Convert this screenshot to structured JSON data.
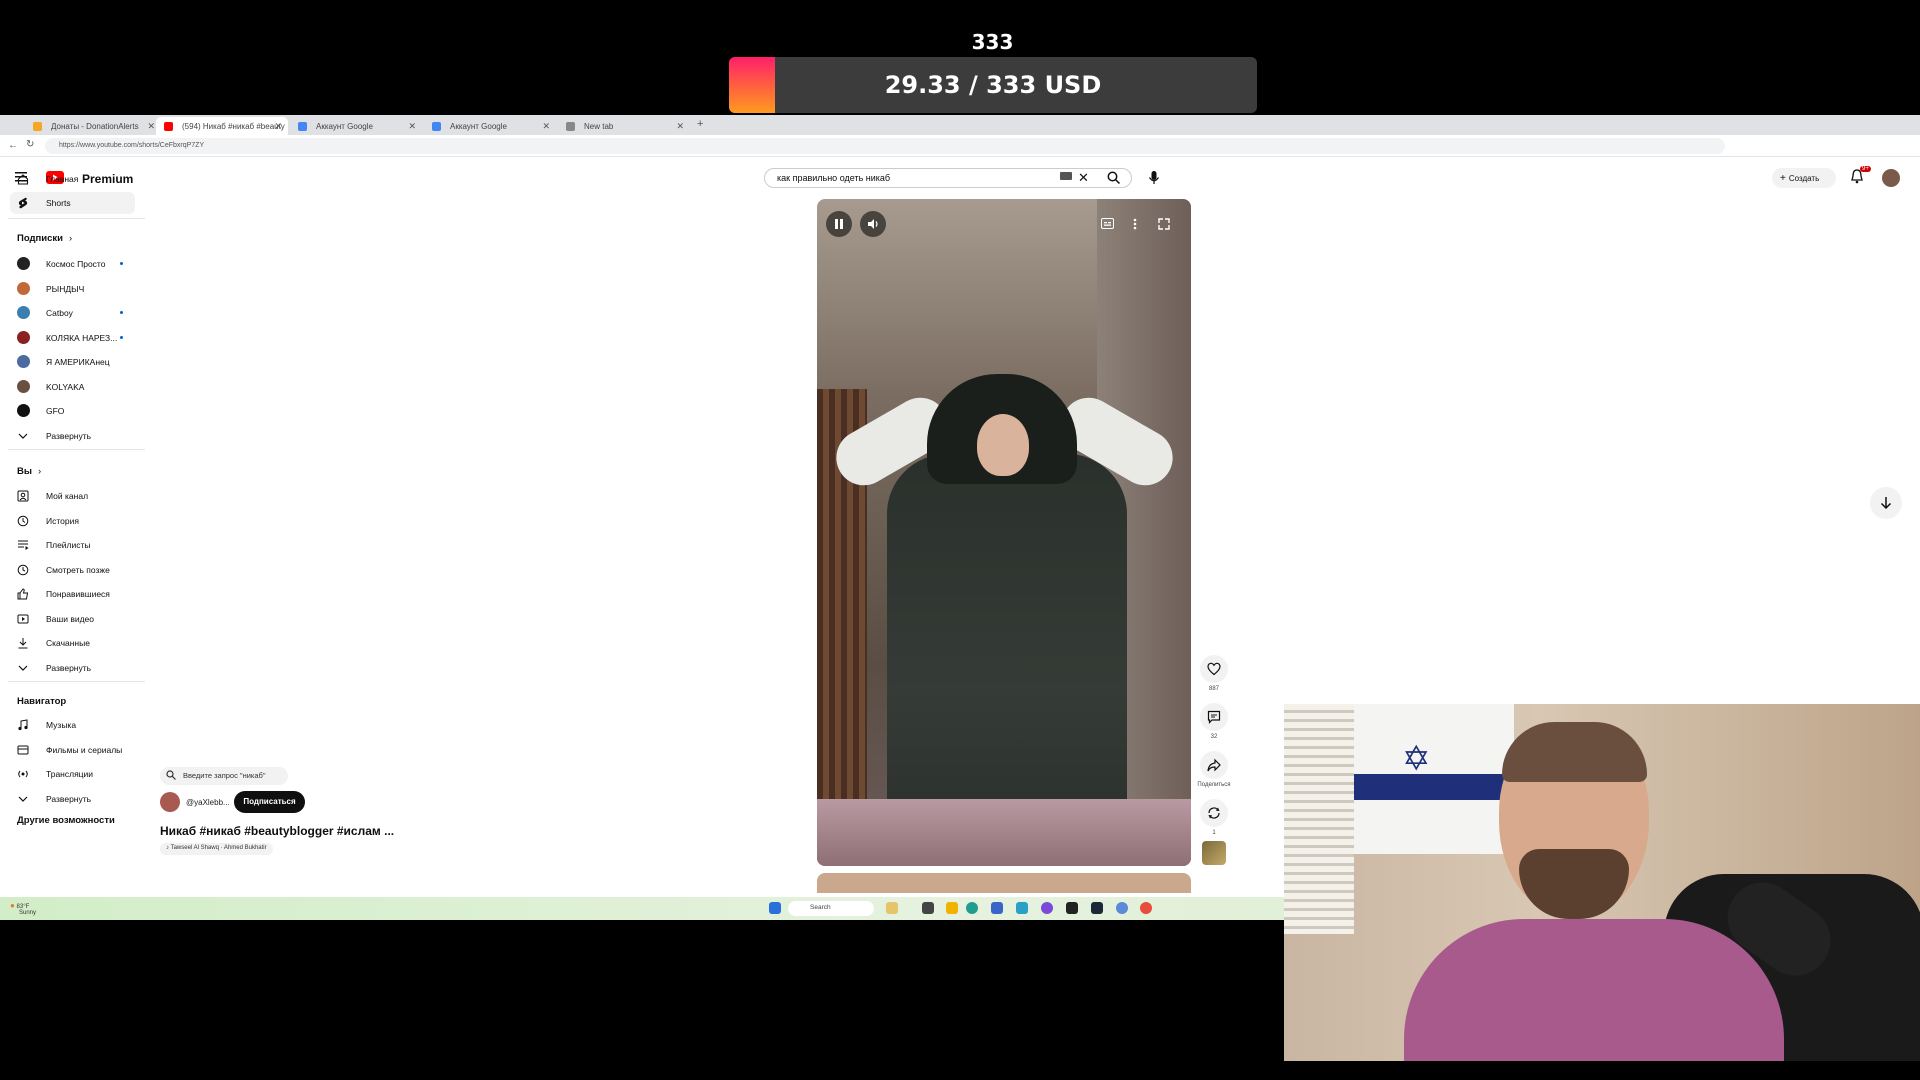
{
  "overlay": {
    "goal_count": "333",
    "goal_text": "29.33 / 333 USD",
    "goal_min": "0",
    "goal_max": "333",
    "goal_progress": 0.088,
    "accent": "#ff3d6e"
  },
  "browser": {
    "tabs": [
      {
        "label": "Донаты - DonationAlerts",
        "favicon_color": "#f5a623",
        "active": false
      },
      {
        "label": "(594) Никаб #никаб #beauty",
        "favicon_color": "#ff0000",
        "active": true
      },
      {
        "label": "Аккаунт Google",
        "favicon_color": "#4285f4",
        "active": false
      },
      {
        "label": "Аккаунт Google",
        "favicon_color": "#4285f4",
        "active": false
      },
      {
        "label": "New tab",
        "favicon_color": "#888888",
        "active": false
      }
    ],
    "url": "https://www.youtube.com/shorts/CeFbxrqP7ZY"
  },
  "youtube": {
    "logo_word": "Premium",
    "search_value": "как правильно одеть никаб",
    "create_label": "Создать",
    "notifications_badge": "9+",
    "brand_color": "#ff0000",
    "sidebar": {
      "main": [
        {
          "label": "Главная",
          "icon": "home-icon",
          "selected": false
        },
        {
          "label": "Shorts",
          "icon": "shorts-icon",
          "selected": true
        }
      ],
      "subscriptions_title": "Подписки",
      "subscriptions": [
        {
          "label": "Космос Просто",
          "color": "#222222",
          "dot": true
        },
        {
          "label": "РЫНДЫЧ",
          "color": "#c06a3a",
          "dot": false
        },
        {
          "label": "Catboy",
          "color": "#3a7fb0",
          "dot": true
        },
        {
          "label": "КОЛЯКА НАРЕЗ...",
          "color": "#8a2020",
          "dot": true
        },
        {
          "label": "Я АМЕРИКАнец",
          "color": "#4a6aa0",
          "dot": false
        },
        {
          "label": "KOLYAKA",
          "color": "#6a5040",
          "dot": false
        },
        {
          "label": "GFO",
          "color": "#111111",
          "dot": false
        }
      ],
      "subs_expand": "Развернуть",
      "you_title": "Вы",
      "you": [
        {
          "label": "Мой канал",
          "icon": "channel-icon"
        },
        {
          "label": "История",
          "icon": "history-icon"
        },
        {
          "label": "Плейлисты",
          "icon": "playlists-icon"
        },
        {
          "label": "Смотреть позже",
          "icon": "watch-later-icon"
        },
        {
          "label": "Понравившиеся",
          "icon": "like-icon"
        },
        {
          "label": "Ваши видео",
          "icon": "your-videos-icon"
        },
        {
          "label": "Скачанные",
          "icon": "download-icon"
        }
      ],
      "you_expand": "Развернуть",
      "nav_title": "Навигатор",
      "navigator": [
        {
          "label": "Музыка",
          "icon": "music-icon"
        },
        {
          "label": "Фильмы и сериалы",
          "icon": "movies-icon"
        },
        {
          "label": "Трансляции",
          "icon": "live-icon"
        }
      ],
      "nav_expand": "Развернуть",
      "more_title": "Другие возможности"
    },
    "short": {
      "search_hint": "Введите запрос \"никаб\"",
      "channel_handle": "@yaXlebb...",
      "subscribe_label": "Подписаться",
      "title": "Никаб #никаб #beautyblogger #ислам ...",
      "music": "Tawseel Al Shawq · Ahmed Bukhatir"
    },
    "actions": {
      "likes": "887",
      "comments": "32",
      "share": "Поделиться",
      "remix": "1"
    }
  },
  "taskbar": {
    "weather_temp": "83°F",
    "weather_desc": "Sunny",
    "search_placeholder": "Search"
  }
}
